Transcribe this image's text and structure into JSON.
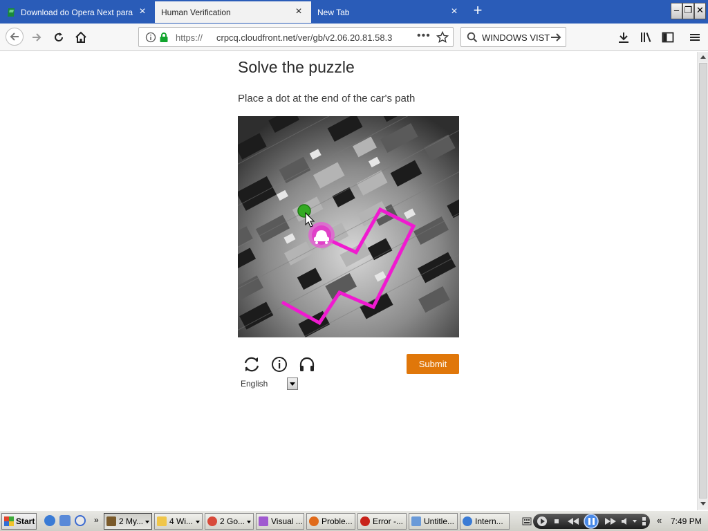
{
  "browser": {
    "tabs": [
      {
        "title": "Download do Opera Next para Wi",
        "active": false
      },
      {
        "title": "Human Verification",
        "active": true
      },
      {
        "title": "New Tab",
        "active": false
      }
    ],
    "new_tab_label": "+",
    "url": {
      "scheme": "https://",
      "rest": "crpcq.cloudfront.net/ver/gb/v2.06.20.81.58.3"
    },
    "search": {
      "text": "WINDOWS VIST"
    },
    "icons": [
      "back-arrow",
      "forward-arrow",
      "reload",
      "home",
      "info",
      "lock",
      "more-dots",
      "star",
      "magnifier",
      "go-arrow",
      "download",
      "library",
      "sidebar",
      "hamburger-menu"
    ],
    "accent_color": "#2a5cb8"
  },
  "captcha": {
    "title": "Solve the puzzle",
    "instruction": "Place a dot at the end of the car's path",
    "path_color": "#f01ad0",
    "dot_color": "#33aa22",
    "submit_label": "Submit",
    "submit_color": "#e0770a",
    "language": "English",
    "icons": [
      "refresh",
      "info",
      "headphones"
    ]
  },
  "taskbar": {
    "start_label": "Start",
    "quick_launch": [
      "internet-explorer",
      "show-desktop",
      "media-player"
    ],
    "more_label": "»",
    "items": [
      {
        "label": "2 My...",
        "active": true,
        "group": true
      },
      {
        "label": "4 Wi...",
        "active": false,
        "group": true
      },
      {
        "label": "2 Go...",
        "active": false,
        "group": true
      },
      {
        "label": "Visual ...",
        "active": false,
        "group": false
      },
      {
        "label": "Proble...",
        "active": false,
        "group": false
      },
      {
        "label": "Error -...",
        "active": false,
        "group": false
      },
      {
        "label": "Untitle...",
        "active": false,
        "group": false
      },
      {
        "label": "Intern...",
        "active": false,
        "group": false
      }
    ],
    "tray_chevron": "«",
    "clock": "7:49 PM"
  }
}
